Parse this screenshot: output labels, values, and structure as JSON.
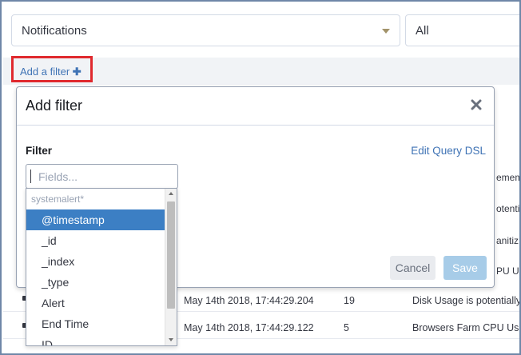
{
  "top": {
    "notifications_select": "Notifications",
    "all_select": "All"
  },
  "filter_bar": {
    "add_filter_label": "Add a filter",
    "plus_icon": "plus-icon"
  },
  "table_rows": [
    {
      "time": "May 14th 2018, 17:44:29.204",
      "count": "19",
      "message": "Disk Usage is potentially"
    },
    {
      "time": "May 14th 2018, 17:44:29.122",
      "count": "5",
      "message": "Browsers Farm CPU Usa"
    }
  ],
  "table_partial": [
    "emem",
    "otentially",
    "anitiz",
    "PU Usag"
  ],
  "modal": {
    "title": "Add filter",
    "close_icon": "close-icon",
    "filter_label": "Filter",
    "edit_query_dsl": "Edit Query DSL",
    "field_placeholder": "Fields...",
    "cancel_label": "Cancel",
    "save_label": "Save"
  },
  "dropdown": {
    "group_label": "systemalert*",
    "items": [
      "@timestamp",
      "_id",
      "_index",
      "_type",
      "Alert",
      "End Time",
      "ID"
    ],
    "selected_index": 0
  },
  "colors": {
    "accent": "#3f73b5",
    "highlight": "#e0292e",
    "selected_item": "#3c7fc4",
    "save_disabled": "#a7cce8"
  }
}
